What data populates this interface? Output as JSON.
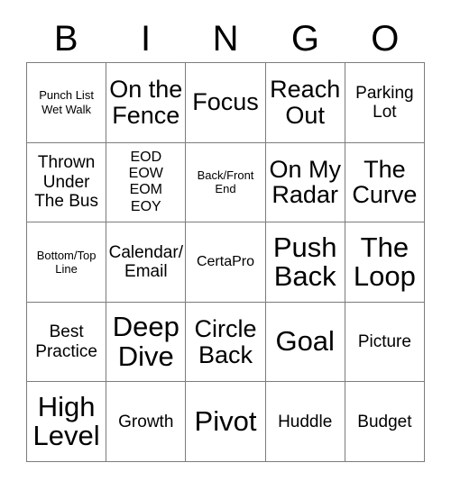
{
  "card": {
    "type": "bingo-card",
    "header": {
      "letters": [
        "B",
        "I",
        "N",
        "G",
        "O"
      ]
    },
    "grid": {
      "columns": 5,
      "rows": 5,
      "border_color": "#7c7c7c",
      "background_color": "#ffffff",
      "text_color": "#000000",
      "cells": [
        {
          "text": "Punch List\nWet Walk",
          "size": "fs-xs"
        },
        {
          "text": "On the\nFence",
          "size": "fs-xl"
        },
        {
          "text": "Focus",
          "size": "fs-xl"
        },
        {
          "text": "Reach\nOut",
          "size": "fs-xl"
        },
        {
          "text": "Parking\nLot",
          "size": "fs-m"
        },
        {
          "text": "Thrown\nUnder\nThe Bus",
          "size": "fs-m"
        },
        {
          "text": "EOD\nEOW\nEOM\nEOY",
          "size": "fs-s"
        },
        {
          "text": "Back/Front\nEnd",
          "size": "fs-xs"
        },
        {
          "text": "On My\nRadar",
          "size": "fs-xl"
        },
        {
          "text": "The\nCurve",
          "size": "fs-xl"
        },
        {
          "text": "Bottom/Top\nLine",
          "size": "fs-xs"
        },
        {
          "text": "Calendar/\nEmail",
          "size": "fs-m"
        },
        {
          "text": "CertaPro",
          "size": "fs-s"
        },
        {
          "text": "Push\nBack",
          "size": "fs-xxl"
        },
        {
          "text": "The\nLoop",
          "size": "fs-xxl"
        },
        {
          "text": "Best\nPractice",
          "size": "fs-m"
        },
        {
          "text": "Deep\nDive",
          "size": "fs-xxl"
        },
        {
          "text": "Circle\nBack",
          "size": "fs-xl"
        },
        {
          "text": "Goal",
          "size": "fs-xxl"
        },
        {
          "text": "Picture",
          "size": "fs-m"
        },
        {
          "text": "High\nLevel",
          "size": "fs-xxl"
        },
        {
          "text": "Growth",
          "size": "fs-m"
        },
        {
          "text": "Pivot",
          "size": "fs-xxl"
        },
        {
          "text": "Huddle",
          "size": "fs-m"
        },
        {
          "text": "Budget",
          "size": "fs-m"
        }
      ]
    }
  }
}
